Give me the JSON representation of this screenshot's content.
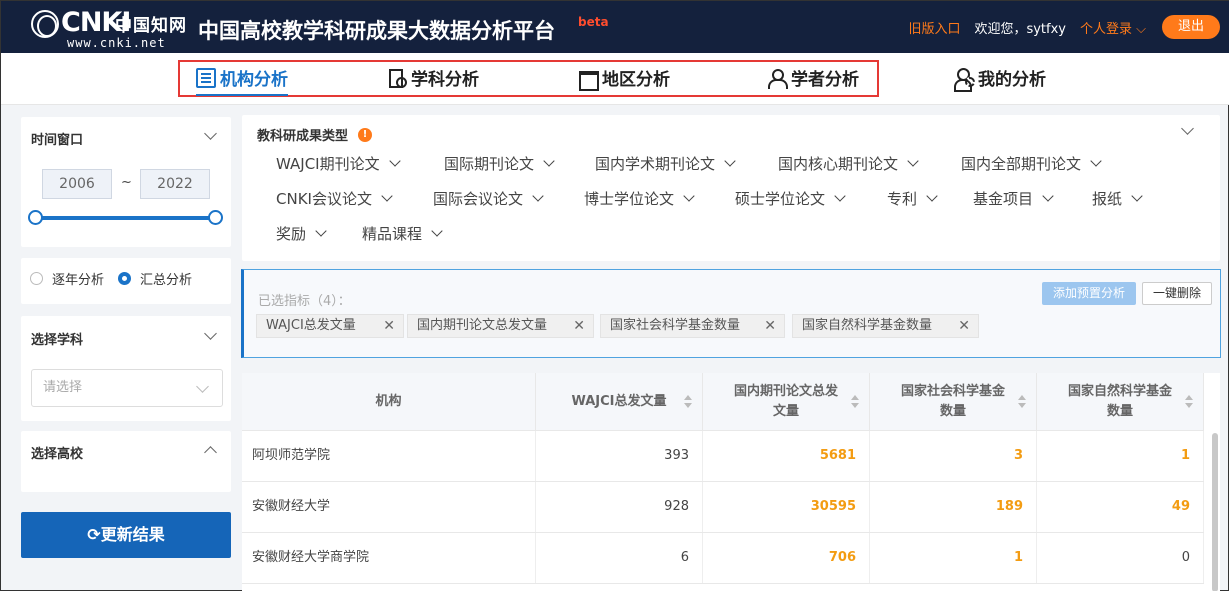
{
  "header": {
    "logo_mark": "CNKI",
    "logo_cn": "中国知网",
    "logo_url": "www.cnki.net",
    "title": "中国高校教学科研成果大数据分析平台",
    "beta": "beta",
    "old_version": "旧版入口",
    "welcome": "欢迎您，sytfxy",
    "login": "个人登录 ⌵",
    "logout": "退出"
  },
  "nav": {
    "items": [
      {
        "label": "机构分析",
        "icon": "building-icon",
        "active": true
      },
      {
        "label": "学科分析",
        "icon": "subject-icon",
        "active": false
      },
      {
        "label": "地区分析",
        "icon": "region-icon",
        "active": false
      },
      {
        "label": "学者分析",
        "icon": "scholar-icon",
        "active": false
      },
      {
        "label": "我的分析",
        "icon": "user-gear-icon",
        "active": false
      }
    ]
  },
  "sidebar": {
    "time_window": {
      "title": "时间窗口",
      "start": "2006",
      "end": "2022",
      "sep": "~"
    },
    "mode": {
      "yearly": "逐年分析",
      "summary": "汇总分析",
      "selected": "summary"
    },
    "subject": {
      "title": "选择学科",
      "placeholder": "请选择"
    },
    "school": {
      "title": "选择高校"
    },
    "update_button": "⟳更新结果"
  },
  "types": {
    "title": "教科研成果类型",
    "warn": "!",
    "items": [
      "WAJCI期刊论文",
      "国际期刊论文",
      "国内学术期刊论文",
      "国内核心期刊论文",
      "国内全部期刊论文",
      "CNKI会议论文",
      "国际会议论文",
      "博士学位论文",
      "硕士学位论文",
      "专利",
      "基金项目",
      "报纸",
      "奖励",
      "精品课程"
    ]
  },
  "selected": {
    "label": "已选指标（4）：",
    "preset_button": "添加预置分析",
    "clear_button": "一键删除",
    "chips": [
      "WAJCI总发文量",
      "国内期刊论文总发文量",
      "国家社会科学基金数量",
      "国家自然科学基金数量"
    ]
  },
  "table": {
    "headers": [
      "机构",
      "WAJCI总发文量",
      "国内期刊论文总发文量",
      "国家社会科学基金数量",
      "国家自然科学基金数量"
    ],
    "rows": [
      [
        "阿坝师范学院",
        "393",
        "5681",
        "3",
        "1"
      ],
      [
        "安徽财经大学",
        "928",
        "30595",
        "189",
        "49"
      ],
      [
        "安徽财经大学商学院",
        "6",
        "706",
        "1",
        "0"
      ]
    ]
  }
}
